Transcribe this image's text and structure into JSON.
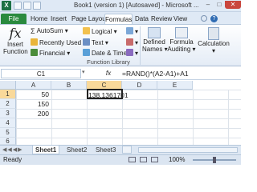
{
  "window": {
    "title": "Book1 (version 1) [Autosaved] - Microsoft ...",
    "app_icon": "X"
  },
  "tabs": [
    "File",
    "Home",
    "Insert",
    "Page Layout",
    "Formulas",
    "Data",
    "Review",
    "View"
  ],
  "ribbon": {
    "insert_function": [
      "Insert",
      "Function"
    ],
    "autosum": "AutoSum",
    "recently_used": "Recently Used",
    "financial": "Financial",
    "logical": "Logical",
    "text": "Text",
    "date_time": "Date & Time",
    "defined_names": [
      "Defined",
      "Names"
    ],
    "formula_auditing": [
      "Formula",
      "Auditing"
    ],
    "calculation": "Calculation",
    "group_label": "Function Library"
  },
  "formula_bar": {
    "name_box": "C1",
    "fx": "fx",
    "formula": "=RAND()*(A2-A1)+A1"
  },
  "grid": {
    "columns": [
      "A",
      "B",
      "C",
      "D",
      "E"
    ],
    "rows": [
      "1",
      "2",
      "3",
      "4",
      "5",
      "6"
    ],
    "cells": {
      "A1": "50",
      "C1": "138.1361701",
      "A2": "150",
      "A3": "200"
    }
  },
  "sheets": [
    "Sheet1",
    "Sheet2",
    "Sheet3"
  ],
  "status": {
    "ready": "Ready",
    "zoom": "100%"
  },
  "colors": {
    "accent": "#2a8a3e",
    "ribbon": "#e4ecf6",
    "header": "#e6eef8"
  }
}
